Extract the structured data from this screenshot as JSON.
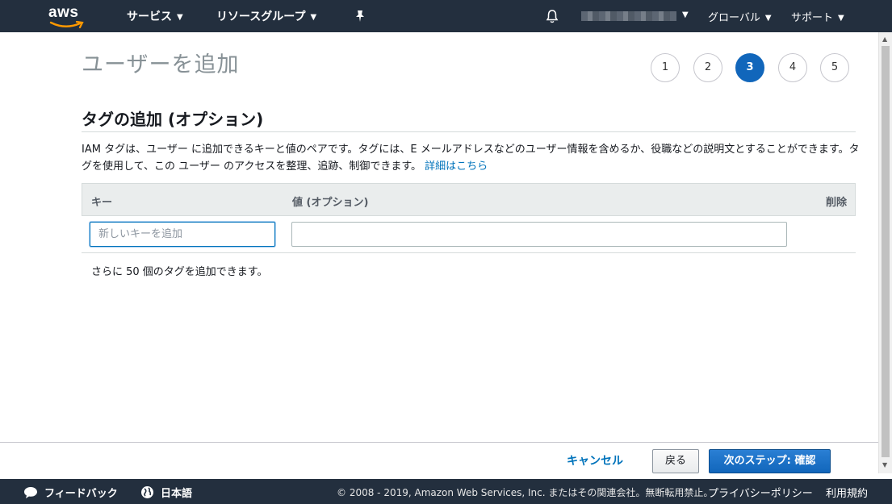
{
  "nav": {
    "logo": "aws",
    "services": "サービス",
    "resource_groups": "リソースグループ",
    "region": "グローバル",
    "support": "サポート"
  },
  "page": {
    "title": "ユーザーを追加",
    "steps": [
      "1",
      "2",
      "3",
      "4",
      "5"
    ],
    "active_step": "3"
  },
  "section": {
    "title": "タグの追加 (オプション)",
    "description": "IAM タグは、ユーザー に追加できるキーと値のペアです。タグには、E メールアドレスなどのユーザー情報を含めるか、役職などの説明文とすることができます。タグを使用して、この ユーザー のアクセスを整理、追跡、制御できます。",
    "learn_more": "詳細はこちら"
  },
  "table": {
    "headers": {
      "key": "キー",
      "value": "値 (オプション)",
      "delete": "削除"
    },
    "key_placeholder": "新しいキーを追加",
    "value_input": ""
  },
  "remaining": "さらに 50 個のタグを追加できます。",
  "actions": {
    "cancel": "キャンセル",
    "back": "戻る",
    "next": "次のステップ: 確認"
  },
  "footer": {
    "feedback": "フィードバック",
    "language": "日本語",
    "copyright": "© 2008 - 2019, Amazon Web Services, Inc. またはその関連会社。無断転用禁止。",
    "privacy": "プライバシーポリシー",
    "terms": "利用規約"
  },
  "colors": {
    "nav_bg": "#232f3e",
    "primary": "#1166bb",
    "link": "#0073bb",
    "logo_smile": "#ff9900"
  }
}
